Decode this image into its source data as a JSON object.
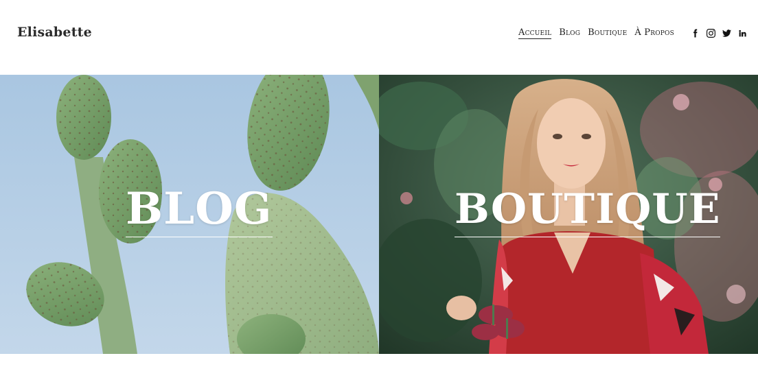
{
  "header": {
    "site_title": "Elisabette",
    "nav": [
      {
        "label": "Accueil",
        "active": true
      },
      {
        "label": "Blog",
        "active": false
      },
      {
        "label": "Boutique",
        "active": false
      },
      {
        "label": "À Propos",
        "active": false
      }
    ],
    "social_icons": [
      "facebook-icon",
      "instagram-icon",
      "twitter-icon",
      "linkedin-icon"
    ]
  },
  "panels": [
    {
      "title": "BLOG",
      "image": "cactus-image"
    },
    {
      "title": "BOUTIQUE",
      "image": "woman-flowers-image"
    }
  ],
  "colors": {
    "sky": "#b8d0e6",
    "cactus": "#8fb07c",
    "foliage": "#2f4a36",
    "dress": "#b3262b"
  }
}
